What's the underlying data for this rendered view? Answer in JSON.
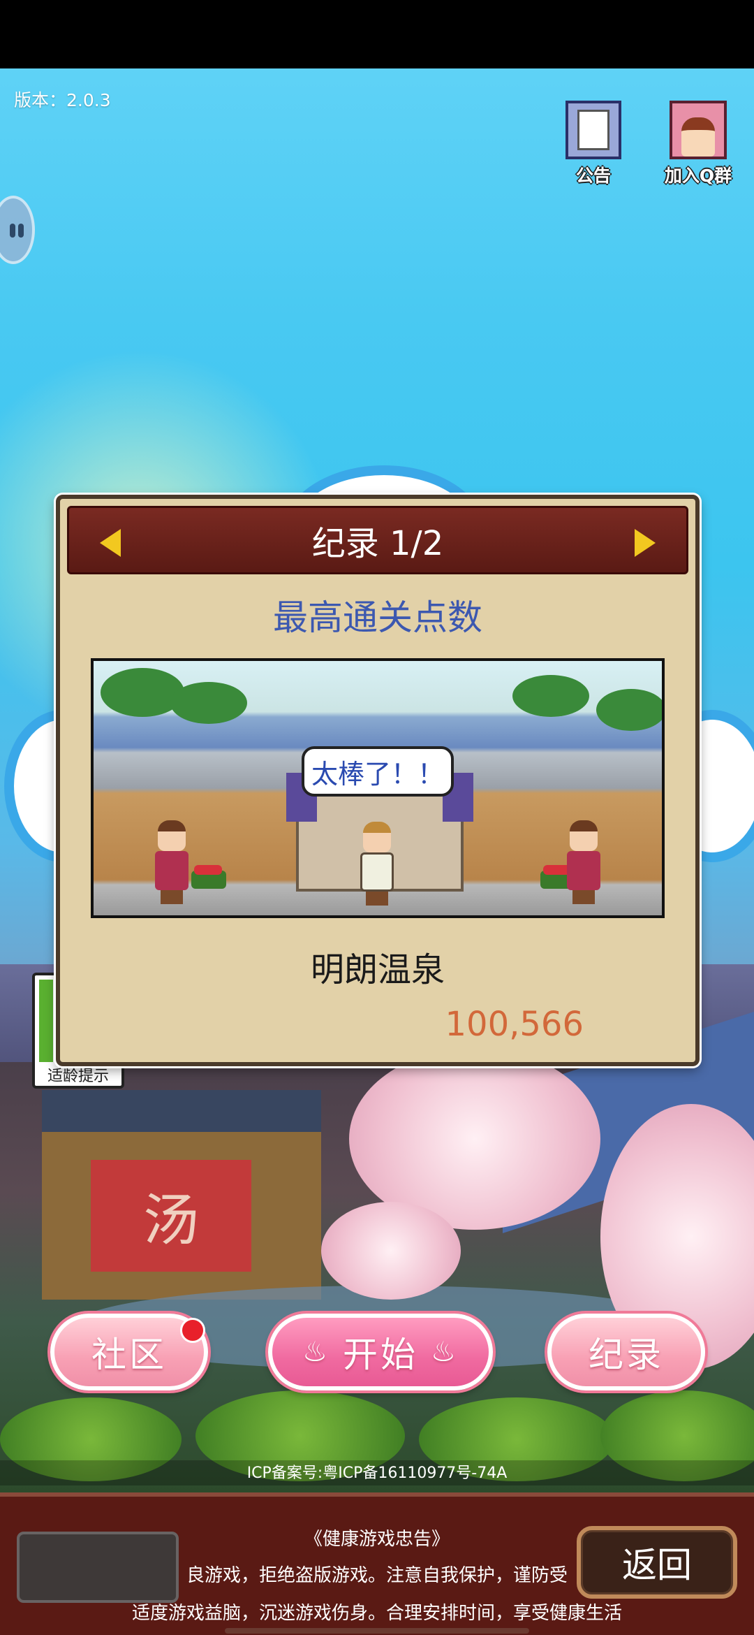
{
  "version_text": "版本：2.0.3",
  "top_buttons": {
    "notice_label": "公告",
    "qq_label": "加入Q群"
  },
  "age_hint": "适龄提示",
  "record_dialog": {
    "title": "纪录 1/2",
    "subtitle": "最高通关点数",
    "scene_bubble": "太棒了！！",
    "onsen_name": "明朗温泉",
    "score": "100,566"
  },
  "scene_sign": "汤",
  "main_buttons": {
    "community": "社区",
    "start": "开始",
    "record": "纪录"
  },
  "icp": "ICP备案号:粤ICP备16110977号-74A",
  "health_notice": {
    "title": "《健康游戏忠告》",
    "line1": "良游戏，拒绝盗版游戏。注意自我保护，谨防受",
    "line2": "适度游戏益脑，沉迷游戏伤身。合理安排时间，享受健康生活"
  },
  "back_label": "返回",
  "colors": {
    "dialog_bg": "#e2d1a8",
    "dialog_header": "#6a2018",
    "subtitle_blue": "#3c58b0",
    "score_orange": "#d2683a",
    "button_pink": "#f8a0b4",
    "footer_bg": "#5a1a14"
  }
}
